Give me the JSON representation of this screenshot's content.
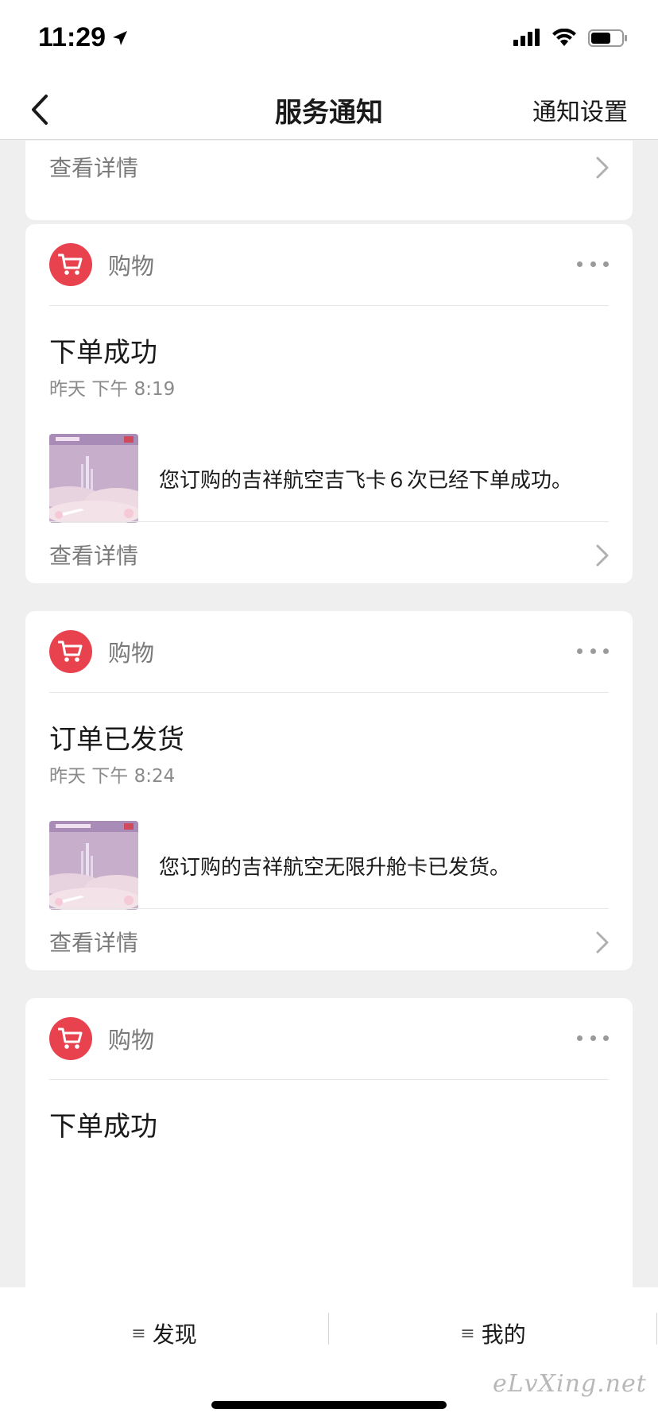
{
  "status_bar": {
    "time": "11:29",
    "icons": [
      "location-arrow-icon",
      "cellular-signal-icon",
      "wifi-icon",
      "battery-icon"
    ]
  },
  "nav": {
    "title": "服务通知",
    "action_label": "通知设置"
  },
  "colors": {
    "accent_red": "#e8424f",
    "background": "#efefef"
  },
  "feed": {
    "partial_card": {
      "footer_label": "查看详情"
    },
    "cards": [
      {
        "source": "购物",
        "title": "下单成功",
        "time": "昨天 下午 8:19",
        "body": "您订购的吉祥航空吉飞卡６次已经下单成功。",
        "footer_label": "查看详情"
      },
      {
        "source": "购物",
        "title": "订单已发货",
        "time": "昨天 下午 8:24",
        "body": "您订购的吉祥航空无限升舱卡已发货。",
        "footer_label": "查看详情"
      },
      {
        "source": "购物",
        "title": "下单成功"
      }
    ]
  },
  "bottom_menu": {
    "tabs": [
      {
        "label": "发现"
      },
      {
        "label": "我的"
      }
    ]
  },
  "watermark": "eLvXing.net"
}
